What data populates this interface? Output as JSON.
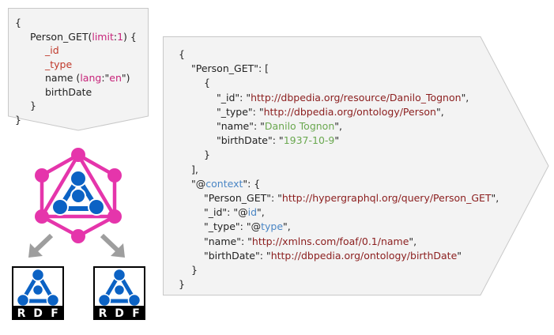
{
  "query": {
    "lines": [
      {
        "parts": [
          {
            "t": "{",
            "c": "k"
          }
        ],
        "indent": 0
      },
      {
        "parts": [
          {
            "t": "Person_GET(",
            "c": "k"
          },
          {
            "t": "limit",
            "c": "p"
          },
          {
            "t": ":",
            "c": "k"
          },
          {
            "t": "1",
            "c": "p"
          },
          {
            "t": ") {",
            "c": "k"
          }
        ],
        "indent": 1
      },
      {
        "parts": [
          {
            "t": "_id",
            "c": "r"
          }
        ],
        "indent": 2
      },
      {
        "parts": [
          {
            "t": "_type",
            "c": "r"
          }
        ],
        "indent": 2
      },
      {
        "parts": [
          {
            "t": "name (",
            "c": "k"
          },
          {
            "t": "lang",
            "c": "p"
          },
          {
            "t": ":\"",
            "c": "k"
          },
          {
            "t": "en",
            "c": "p"
          },
          {
            "t": "\")",
            "c": "k"
          }
        ],
        "indent": 2
      },
      {
        "parts": [
          {
            "t": "birthDate",
            "c": "k"
          }
        ],
        "indent": 2
      },
      {
        "parts": [
          {
            "t": "}",
            "c": "k"
          }
        ],
        "indent": 1
      },
      {
        "parts": [
          {
            "t": "}",
            "c": "k"
          }
        ],
        "indent": 0
      }
    ]
  },
  "response": {
    "lines": [
      {
        "parts": [
          {
            "t": "{",
            "c": "k"
          }
        ],
        "indent": 0
      },
      {
        "parts": [
          {
            "t": "\"Person_GET\": [",
            "c": "k"
          }
        ],
        "indent": 1
      },
      {
        "parts": [
          {
            "t": "{",
            "c": "k"
          }
        ],
        "indent": 2
      },
      {
        "parts": [
          {
            "t": "\"_id\": \"",
            "c": "k"
          },
          {
            "t": "http://dbpedia.org/resource/Danilo_Tognon",
            "c": "s"
          },
          {
            "t": "\",",
            "c": "k"
          }
        ],
        "indent": 3
      },
      {
        "parts": [
          {
            "t": "\"_type\": \"",
            "c": "k"
          },
          {
            "t": "http://dbpedia.org/ontology/Person",
            "c": "s"
          },
          {
            "t": "\",",
            "c": "k"
          }
        ],
        "indent": 3
      },
      {
        "parts": [
          {
            "t": "\"name\": \"",
            "c": "k"
          },
          {
            "t": "Danilo Tognon",
            "c": "g"
          },
          {
            "t": "\",",
            "c": "k"
          }
        ],
        "indent": 3
      },
      {
        "parts": [
          {
            "t": "\"birthDate\": \"",
            "c": "k"
          },
          {
            "t": "1937-10-9",
            "c": "g"
          },
          {
            "t": "\"",
            "c": "k"
          }
        ],
        "indent": 3
      },
      {
        "parts": [
          {
            "t": "}",
            "c": "k"
          }
        ],
        "indent": 2
      },
      {
        "parts": [
          {
            "t": "],",
            "c": "k"
          }
        ],
        "indent": 1
      },
      {
        "parts": [
          {
            "t": "\"@",
            "c": "k"
          },
          {
            "t": "context",
            "c": "b"
          },
          {
            "t": "\": {",
            "c": "k"
          }
        ],
        "indent": 1
      },
      {
        "parts": [
          {
            "t": "\"Person_GET\": \"",
            "c": "k"
          },
          {
            "t": "http://hypergraphql.org/query/Person_GET",
            "c": "s"
          },
          {
            "t": "\",",
            "c": "k"
          }
        ],
        "indent": 2
      },
      {
        "parts": [
          {
            "t": "\"_id\": \"@",
            "c": "k"
          },
          {
            "t": "id",
            "c": "b"
          },
          {
            "t": "\",",
            "c": "k"
          }
        ],
        "indent": 2
      },
      {
        "parts": [
          {
            "t": "\"_type\": \"@",
            "c": "k"
          },
          {
            "t": "type",
            "c": "b"
          },
          {
            "t": "\",",
            "c": "k"
          }
        ],
        "indent": 2
      },
      {
        "parts": [
          {
            "t": "\"name\": \"",
            "c": "k"
          },
          {
            "t": "http://xmlns.com/foaf/0.1/name",
            "c": "s"
          },
          {
            "t": "\",",
            "c": "k"
          }
        ],
        "indent": 2
      },
      {
        "parts": [
          {
            "t": "\"birthDate\": \"",
            "c": "k"
          },
          {
            "t": "http://dbpedia.org/ontology/birthDate",
            "c": "s"
          },
          {
            "t": "\"",
            "c": "k"
          }
        ],
        "indent": 2
      },
      {
        "parts": [
          {
            "t": "}",
            "c": "k"
          }
        ],
        "indent": 1
      },
      {
        "parts": [
          {
            "t": "}",
            "c": "k"
          }
        ],
        "indent": 0
      }
    ]
  },
  "rdf_logos": [
    {
      "letters": [
        "R",
        "D",
        "F"
      ]
    },
    {
      "letters": [
        "R",
        "D",
        "F"
      ]
    }
  ],
  "colors": {
    "box_fill": "#f3f3f3",
    "box_stroke": "#c8c8c8",
    "graphql_pink": "#e535ab",
    "rdf_blue": "#0b62c4",
    "arrow_gray": "#9e9e9e"
  }
}
